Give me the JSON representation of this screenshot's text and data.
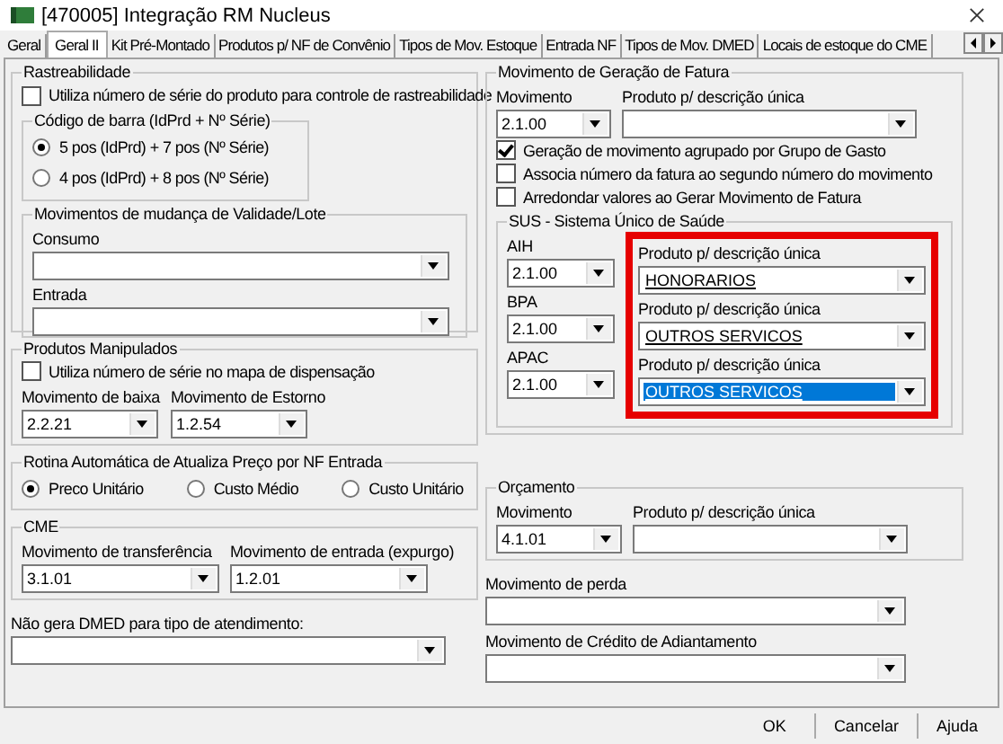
{
  "window": {
    "title": "[470005]  Integração RM Nucleus"
  },
  "tabs": [
    {
      "label": "Geral",
      "selected": false
    },
    {
      "label": "Geral II",
      "selected": true
    },
    {
      "label": "Kit Pré-Montado",
      "selected": false
    },
    {
      "label": "Produtos p/ NF de Convênio",
      "selected": false
    },
    {
      "label": "Tipos de Mov. Estoque",
      "selected": false
    },
    {
      "label": "Entrada NF",
      "selected": false
    },
    {
      "label": "Tipos de Mov. DMED",
      "selected": false
    },
    {
      "label": "Locais de estoque do CME",
      "selected": false
    }
  ],
  "rastreabilidade": {
    "title": "Rastreabilidade",
    "checkbox": {
      "label": "Utiliza número de série do produto para controle de rastreabilidade",
      "checked": false
    },
    "barcode": {
      "title": "Código de barra (IdPrd + Nº Série)",
      "options": [
        {
          "label": "5 pos (IdPrd) + 7 pos (Nº Série)",
          "selected": true
        },
        {
          "label": "4 pos (IdPrd) + 8 pos (Nº Série)",
          "selected": false
        }
      ]
    },
    "validade": {
      "title": "Movimentos de mudança de Validade/Lote",
      "fields": [
        {
          "label": "Consumo"
        },
        {
          "label": "Entrada"
        }
      ]
    }
  },
  "manipulados": {
    "title": "Produtos Manipulados",
    "checkbox": {
      "label": "Utiliza número de série no mapa de dispensação",
      "checked": false
    },
    "fields": [
      {
        "label": "Movimento de baixa",
        "value": "2.2.21"
      },
      {
        "label": "Movimento de Estorno",
        "value": "1.2.54"
      }
    ]
  },
  "rotina": {
    "title": "Rotina Automática de Atualiza Preço por NF Entrada",
    "options": [
      {
        "label": "Preco Unitário",
        "selected": true
      },
      {
        "label": "Custo Médio",
        "selected": false
      },
      {
        "label": "Custo Unitário",
        "selected": false
      }
    ]
  },
  "cme": {
    "title": "CME",
    "fields": [
      {
        "label": "Movimento de transferência",
        "value": "3.1.01"
      },
      {
        "label": "Movimento de entrada (expurgo)",
        "value": "1.2.01"
      }
    ]
  },
  "dmed": {
    "label": "Não gera DMED para tipo de atendimento:"
  },
  "fatura": {
    "title": "Movimento de Geração de Fatura",
    "fields": [
      {
        "label": "Movimento",
        "value": "2.1.00"
      },
      {
        "label": "Produto p/ descrição única"
      }
    ],
    "checkboxes": [
      {
        "label": "Geração de movimento agrupado por Grupo de Gasto",
        "checked": true
      },
      {
        "label": "Associa número da fatura ao segundo número do movimento",
        "checked": false
      },
      {
        "label": "Arredondar valores ao Gerar Movimento de Fatura",
        "checked": false
      }
    ],
    "sus": {
      "title": "SUS - Sistema Único de Saúde",
      "rows": [
        {
          "label": "AIH",
          "value": "2.1.00",
          "product_label": "Produto p/ descrição única",
          "product_value": "HONORARIOS",
          "selected": false
        },
        {
          "label": "BPA",
          "value": "2.1.00",
          "product_label": "Produto p/ descrição única",
          "product_value": "OUTROS SERVICOS",
          "selected": false
        },
        {
          "label": "APAC",
          "value": "2.1.00",
          "product_label": "Produto p/ descrição única",
          "product_value": "OUTROS SERVICOS",
          "selected": true
        }
      ]
    }
  },
  "orcamento": {
    "title": "Orçamento",
    "fields": [
      {
        "label": "Movimento",
        "value": "4.1.01"
      },
      {
        "label": "Produto p/ descrição única"
      }
    ]
  },
  "perda": {
    "label": "Movimento de perda"
  },
  "credito": {
    "label": "Movimento de Crédito de Adiantamento"
  },
  "buttons": [
    "OK",
    "Cancelar",
    "Ajuda"
  ]
}
